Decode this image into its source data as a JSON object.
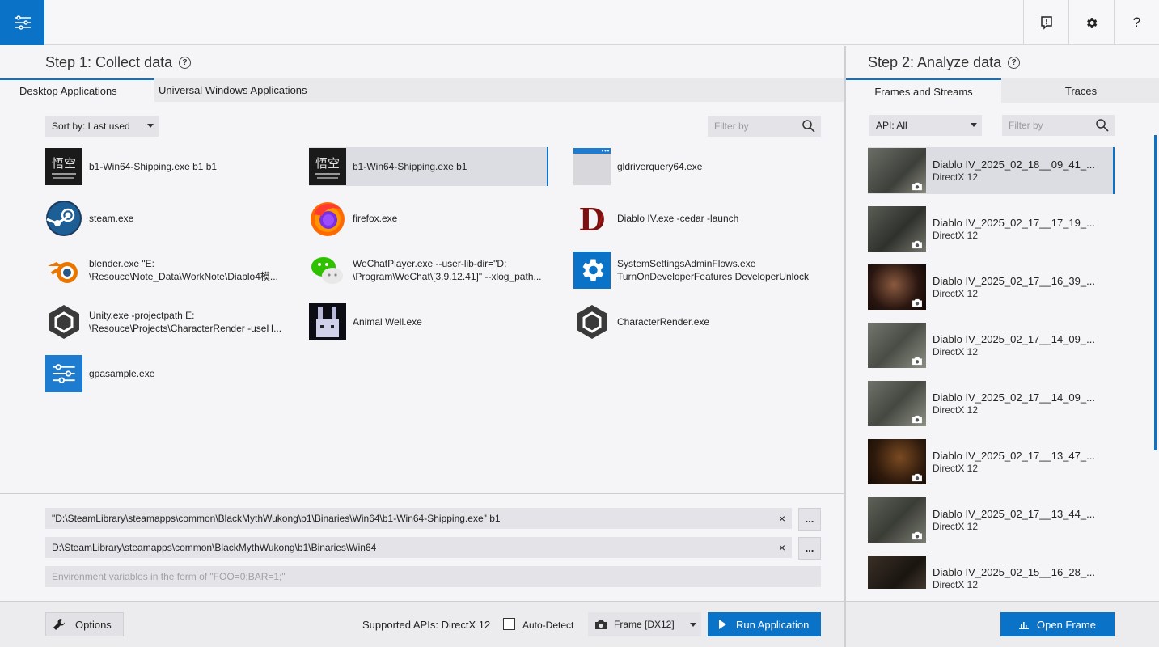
{
  "header": {
    "menu_icon": "sliders-icon",
    "icons": [
      "feedback-icon",
      "gear-icon",
      "help-icon"
    ],
    "help_label": "?"
  },
  "step1": {
    "title": "Step 1: Collect data",
    "tabs": [
      "Desktop Applications",
      "Universal Windows Applications"
    ],
    "sort_label": "Sort by: Last used",
    "filter_placeholder": "Filter by",
    "apps": [
      {
        "label": "b1-Win64-Shipping.exe b1 b1",
        "icon": "wukong-icon"
      },
      {
        "label": "b1-Win64-Shipping.exe b1",
        "icon": "wukong-icon",
        "selected": true
      },
      {
        "label": "gldriverquery64.exe",
        "icon": "window-icon"
      },
      {
        "label": "steam.exe",
        "icon": "steam-icon"
      },
      {
        "label": "firefox.exe",
        "icon": "firefox-icon"
      },
      {
        "label": "Diablo IV.exe -cedar -launch",
        "icon": "diablo-icon"
      },
      {
        "label": "blender.exe \"E:\n\\Resouce\\Note_Data\\WorkNote\\Diablo4模...",
        "icon": "blender-icon"
      },
      {
        "label": "WeChatPlayer.exe --user-lib-dir=\"D:\n\\Program\\WeChat\\[3.9.12.41]\" --xlog_path...",
        "icon": "wechat-icon"
      },
      {
        "label": "SystemSettingsAdminFlows.exe\nTurnOnDeveloperFeatures DeveloperUnlock",
        "icon": "settings-gear-icon"
      },
      {
        "label": "Unity.exe -projectpath E:\n\\Resouce\\Projects\\CharacterRender -useH...",
        "icon": "unity-icon"
      },
      {
        "label": "Animal Well.exe",
        "icon": "animal-well-icon"
      },
      {
        "label": "CharacterRender.exe",
        "icon": "unity-icon"
      },
      {
        "label": "gpasample.exe",
        "icon": "sliders-icon"
      }
    ],
    "command_value": "\"D:\\SteamLibrary\\steamapps\\common\\BlackMythWukong\\b1\\Binaries\\Win64\\b1-Win64-Shipping.exe\" b1",
    "workdir_value": "D:\\SteamLibrary\\steamapps\\common\\BlackMythWukong\\b1\\Binaries\\Win64",
    "env_placeholder": "Environment variables in the form of \"FOO=0;BAR=1;\"",
    "clear_label": "×",
    "browse_label": "...",
    "options_label": "Options",
    "supported_apis": "Supported APIs: DirectX 12",
    "auto_detect_label": "Auto-Detect",
    "auto_detect_checked": false,
    "capture_mode": "Frame [DX12]",
    "run_label": "Run Application"
  },
  "step2": {
    "title": "Step 2: Analyze data",
    "tabs": [
      "Frames and Streams",
      "Traces"
    ],
    "api_filter": "API: All",
    "filter_placeholder": "Filter by",
    "frames": [
      {
        "name": "Diablo IV_2025_02_18__09_41_...",
        "api": "DirectX 12",
        "selected": true
      },
      {
        "name": "Diablo IV_2025_02_17__17_19_...",
        "api": "DirectX 12"
      },
      {
        "name": "Diablo IV_2025_02_17__16_39_...",
        "api": "DirectX 12"
      },
      {
        "name": "Diablo IV_2025_02_17__14_09_...",
        "api": "DirectX 12"
      },
      {
        "name": "Diablo IV_2025_02_17__14_09_...",
        "api": "DirectX 12"
      },
      {
        "name": "Diablo IV_2025_02_17__13_47_...",
        "api": "DirectX 12"
      },
      {
        "name": "Diablo IV_2025_02_17__13_44_...",
        "api": "DirectX 12"
      },
      {
        "name": "Diablo IV_2025_02_15__16_28_...",
        "api": "DirectX 12"
      }
    ],
    "open_label": "Open Frame"
  },
  "colors": {
    "accent": "#0a73c7",
    "selected_bg": "#dcdde3"
  }
}
